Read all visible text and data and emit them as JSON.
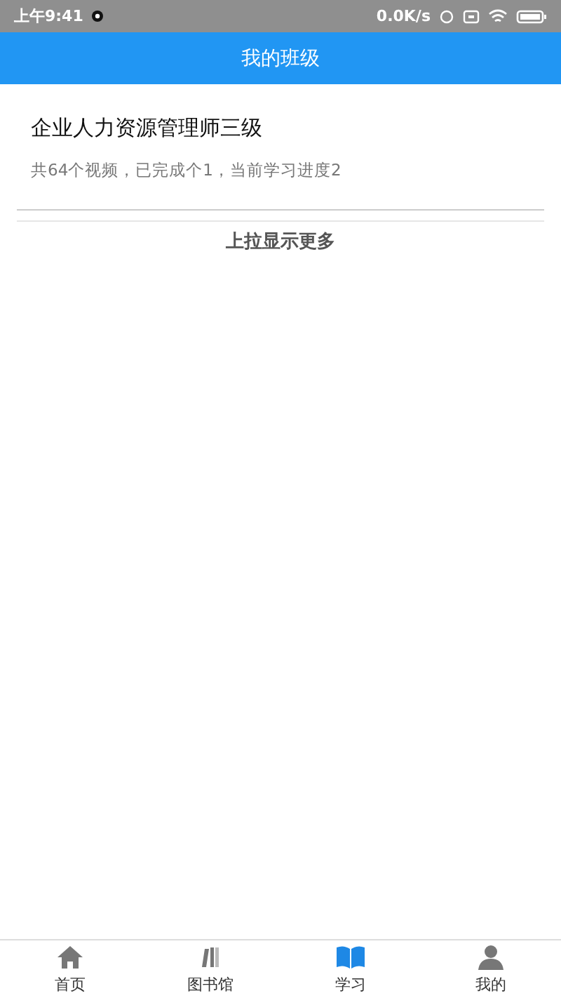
{
  "status_bar": {
    "time": "上午9:41",
    "speed": "0.0K/s"
  },
  "header": {
    "title": "我的班级"
  },
  "classes": [
    {
      "title": "企业人力资源管理师三级",
      "summary": "共64个视频，已完成个1，当前学习进度2"
    }
  ],
  "load_more": "上拉显示更多",
  "tabs": [
    {
      "kind": "home",
      "label": "首页",
      "selected": false
    },
    {
      "kind": "library",
      "label": "图书馆",
      "selected": false
    },
    {
      "kind": "study",
      "label": "学习",
      "selected": true
    },
    {
      "kind": "profile",
      "label": "我的",
      "selected": false
    }
  ]
}
